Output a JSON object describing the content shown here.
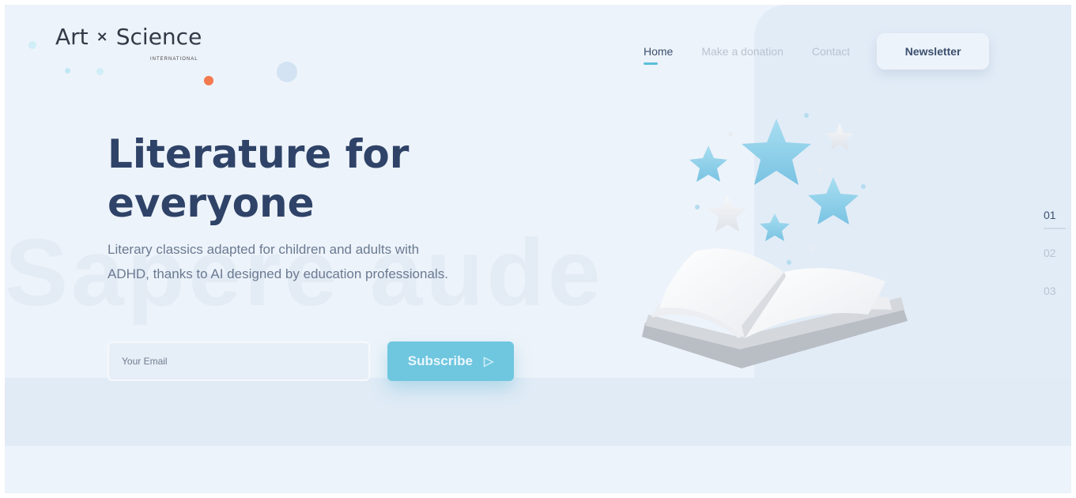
{
  "logo": {
    "part1": "Art",
    "separator": "×",
    "part2": "Science",
    "subtitle": "INTERNATIONAL"
  },
  "nav": {
    "items": [
      {
        "label": "Home",
        "active": true
      },
      {
        "label": "Make a donation",
        "active": false
      },
      {
        "label": "Contact",
        "active": false
      }
    ],
    "newsletter_label": "Newsletter"
  },
  "hero": {
    "title_line1": "Literature for",
    "title_line2": "everyone",
    "description": "Literary classics adapted for children and adults with ADHD, thanks to AI designed by education professionals.",
    "watermark": "Sapere aude",
    "email_placeholder": "Your Email",
    "subscribe_label": "Subscribe"
  },
  "slides": {
    "items": [
      "01",
      "02",
      "03"
    ],
    "active_index": 0
  },
  "illustration": {
    "subject": "open-book-with-stars-icon"
  },
  "colors": {
    "accent": "#6fc6df",
    "heading": "#2f4368",
    "background": "#edf3fa",
    "star_blue": "#8fd0ea",
    "star_white": "#eef1f5"
  }
}
